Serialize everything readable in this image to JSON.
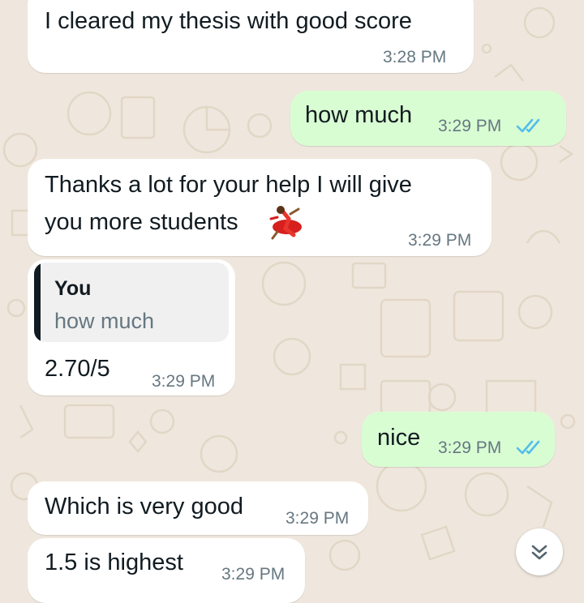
{
  "colors": {
    "incoming_bubble": "#ffffff",
    "outgoing_bubble": "#d9fdd3",
    "wallpaper": "#efe7dd",
    "read_ticks": "#53bdeb",
    "timestamp": "#667781"
  },
  "messages": [
    {
      "direction": "incoming",
      "text": "I cleared my thesis with good score",
      "time": "3:28 PM"
    },
    {
      "direction": "outgoing",
      "text": "how much",
      "time": "3:29 PM",
      "status_icon": "double-check-read-icon"
    },
    {
      "direction": "incoming",
      "text_line1": "Thanks a lot for your help I will give",
      "text_line2": "you more students",
      "emoji": "dancer-emoji",
      "time": "3:29 PM"
    },
    {
      "direction": "incoming",
      "quote": {
        "author": "You",
        "text": "how much"
      },
      "text": "2.70/5",
      "time": "3:29 PM"
    },
    {
      "direction": "outgoing",
      "text": "nice",
      "time": "3:29 PM",
      "status_icon": "double-check-read-icon"
    },
    {
      "direction": "incoming",
      "text": "Which is very good",
      "time": "3:29 PM"
    },
    {
      "direction": "incoming",
      "text": "1.5 is highest",
      "time": "3:29 PM"
    }
  ],
  "scroll_button_icon": "double-chevron-down-icon"
}
